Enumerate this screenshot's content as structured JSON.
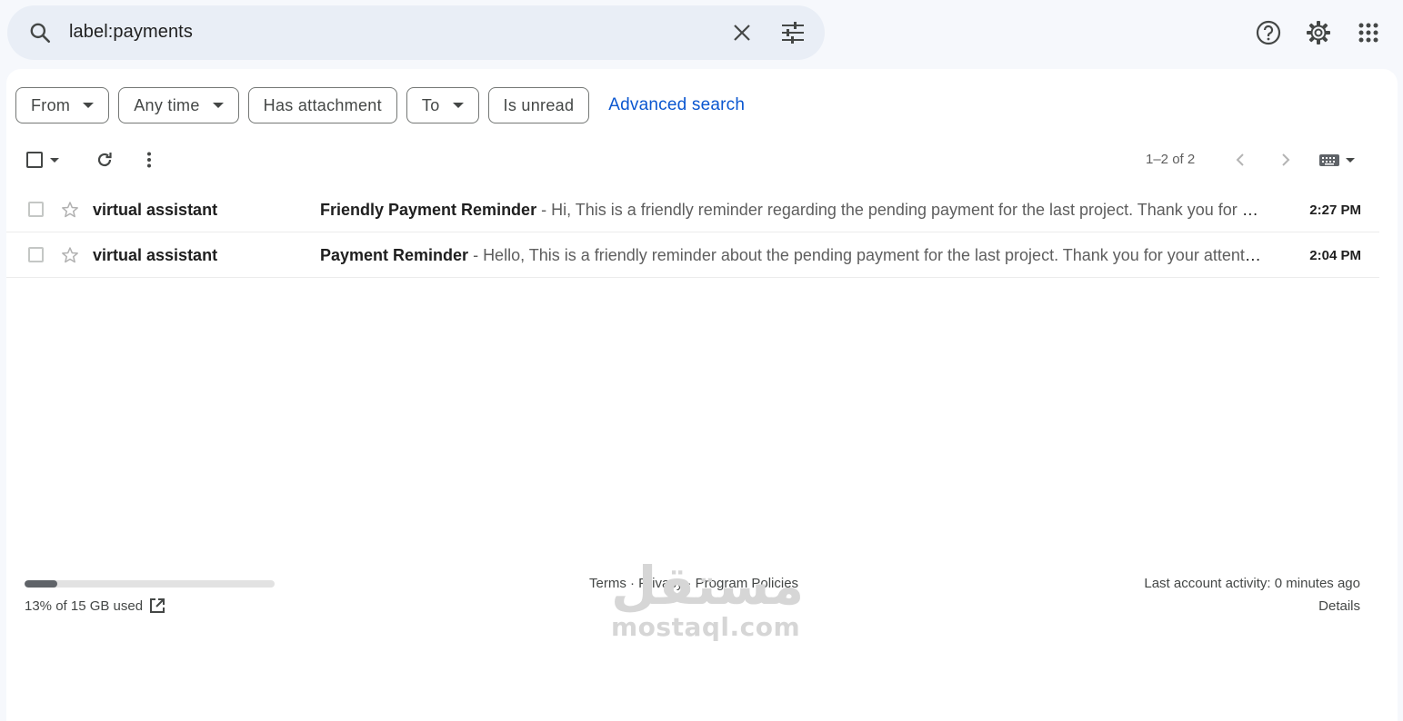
{
  "search": {
    "query": "label:payments",
    "search_icon": "search-icon",
    "clear_icon": "close-icon",
    "options_icon": "tune-icon"
  },
  "header_icons": [
    "help-icon",
    "settings-gear-icon",
    "apps-grid-icon"
  ],
  "filters": {
    "chips": [
      {
        "label": "From",
        "has_dropdown": true
      },
      {
        "label": "Any time",
        "has_dropdown": true
      },
      {
        "label": "Has attachment",
        "has_dropdown": false
      },
      {
        "label": "To",
        "has_dropdown": true
      },
      {
        "label": "Is unread",
        "has_dropdown": false
      }
    ],
    "advanced_search": "Advanced search"
  },
  "toolbar": {
    "pagination": "1–2 of 2"
  },
  "messages": [
    {
      "sender": "virtual assistant",
      "subject": "Friendly Payment Reminder",
      "separator": " - ",
      "snippet": "Hi, This is a friendly reminder regarding the pending payment for the last project. Thank you for your attention.",
      "time": "2:27 PM",
      "starred": false,
      "unread": true
    },
    {
      "sender": "virtual assistant",
      "subject": "Payment Reminder",
      "separator": " - ",
      "snippet": "Hello, This is a friendly reminder about the pending payment for the last project. Thank you for your attention.",
      "time": "2:04 PM",
      "starred": false,
      "unread": true
    }
  ],
  "footer": {
    "storage_used_fraction": 0.13,
    "storage_text": "13% of 15 GB used",
    "links": "Terms · Privacy · Program Policies",
    "last_activity": "Last account activity: 0 minutes ago",
    "details": "Details"
  },
  "watermark": {
    "arabic": "مستقل",
    "latin": "mostaql.com"
  },
  "colors": {
    "background": "#f6f8fc",
    "search_bg": "#e9eef6",
    "link_blue": "#0b57d0",
    "storage_fill": "#5f6368"
  }
}
